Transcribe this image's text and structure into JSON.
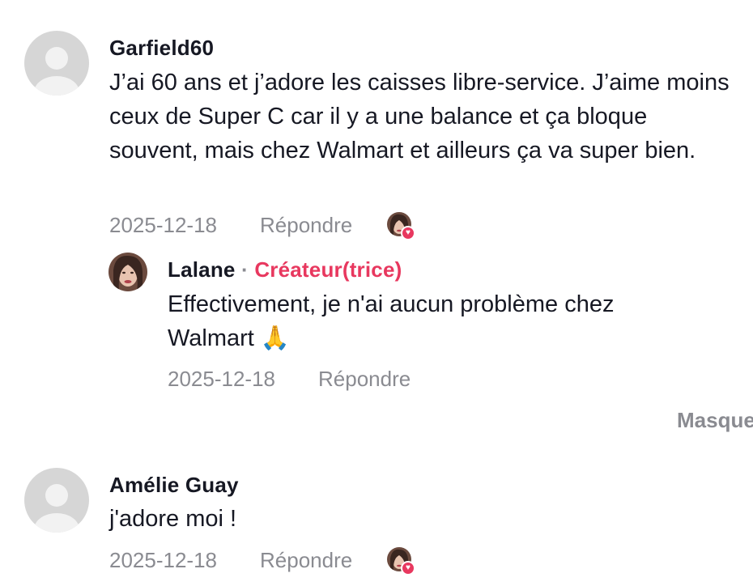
{
  "comments": [
    {
      "author": "Garfield60",
      "text": "J’ai 60 ans et j’adore les caisses libre-service. J’aime moins ceux de Super C car il y a une balance et ça bloque souvent, mais chez Walmart et ailleurs ça va super bien.",
      "date": "2025-12-18",
      "reply_label": "Répondre",
      "creator_liked": true,
      "replies": [
        {
          "author": "Lalane",
          "separator": "·",
          "badge": "Créateur(trice)",
          "text": "Effectivement, je n'ai aucun problème chez Walmart 🙏",
          "date": "2025-12-18",
          "reply_label": "Répondre"
        }
      ],
      "hide_label": "Masquer"
    },
    {
      "author": "Amélie Guay",
      "text": "j'adore moi !",
      "date": "2025-12-18",
      "reply_label": "Répondre",
      "creator_liked": true
    }
  ],
  "colors": {
    "text_primary": "#161823",
    "text_secondary": "#8a8b91",
    "creator_accent": "#e8385f",
    "default_avatar": "#d6d6d6"
  },
  "icons": {
    "default_avatar": "user-silhouette-icon",
    "creator_like_badge": "heart-icon",
    "pray_emoji": "folded-hands-emoji"
  }
}
